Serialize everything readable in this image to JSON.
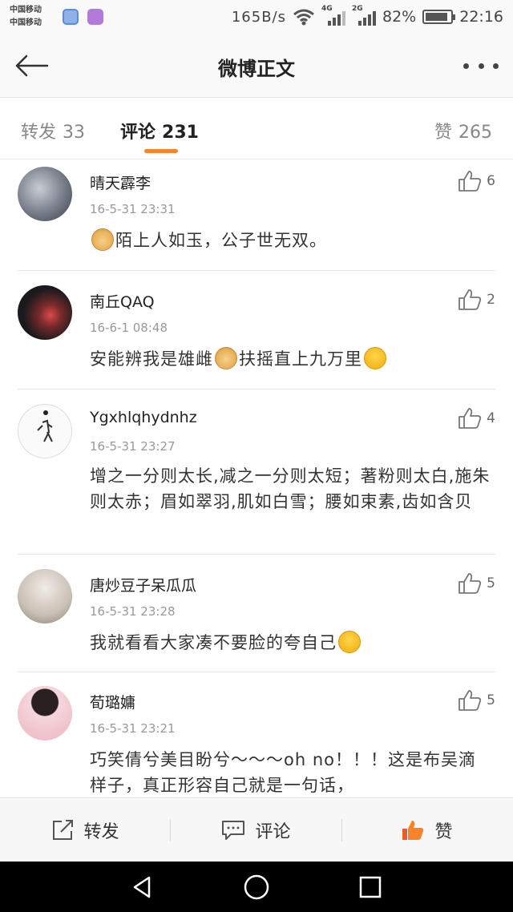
{
  "status_bar": {
    "carrier_1": "中国移动",
    "carrier_2": "中国移动",
    "speed": "165B/s",
    "network_1": "4G",
    "network_2": "2G",
    "battery": "82%",
    "time": "22:16"
  },
  "header": {
    "title": "微博正文",
    "back_icon": "arrow-left-icon",
    "more_icon": "more-dots-icon"
  },
  "tabs": {
    "repost_label": "转发",
    "repost_count": "33",
    "comment_label": "评论",
    "comment_count": "231",
    "like_label": "赞",
    "like_count": "265",
    "active": "comment",
    "accent_color": "#f7842a"
  },
  "comments": [
    {
      "name": "晴天霹李",
      "time": "16-5-31 23:31",
      "text_before": "",
      "emoji_1": "doge",
      "text_middle": "陌上人如玉，公子世无双。",
      "emoji_2": "",
      "text_after": "",
      "likes": "6"
    },
    {
      "name": "南丘QAQ",
      "time": "16-6-1 08:48",
      "text_before": "安能辨我是雄雌",
      "emoji_1": "doge",
      "text_middle": "扶摇直上九万里",
      "emoji_2": "laugh-cry",
      "text_after": "",
      "likes": "2"
    },
    {
      "name": "Ygxhlqhydnhz",
      "time": "16-5-31 23:27",
      "text_before": "增之一分则太长,减之一分则太短；著粉则太白,施朱则太赤；眉如翠羽,肌如白雪；腰如束素,齿如含贝",
      "emoji_1": "",
      "text_middle": "",
      "emoji_2": "",
      "text_after": "",
      "likes": "4"
    },
    {
      "name": "唐炒豆子呆瓜瓜",
      "time": "16-5-31 23:28",
      "text_before": "我就看看大家凑不要脸的夸自己",
      "emoji_1": "laugh",
      "text_middle": "",
      "emoji_2": "",
      "text_after": "",
      "likes": "5"
    },
    {
      "name": "荀璐嫞",
      "time": "16-5-31 23:21",
      "text_before": "巧笑倩兮美目盼兮～～～oh no！！！这是布吴滴样子，真正形容自己就是一句话，",
      "emoji_1": "",
      "text_middle": "",
      "emoji_2": "",
      "text_after": "",
      "likes": "5"
    }
  ],
  "action_bar": {
    "repost_label": "转发",
    "comment_label": "评论",
    "like_label": "赞",
    "like_color": "#f05a28"
  },
  "nav_bar": {
    "back_icon": "triangle-back-icon",
    "home_icon": "circle-home-icon",
    "recents_icon": "square-recents-icon"
  }
}
